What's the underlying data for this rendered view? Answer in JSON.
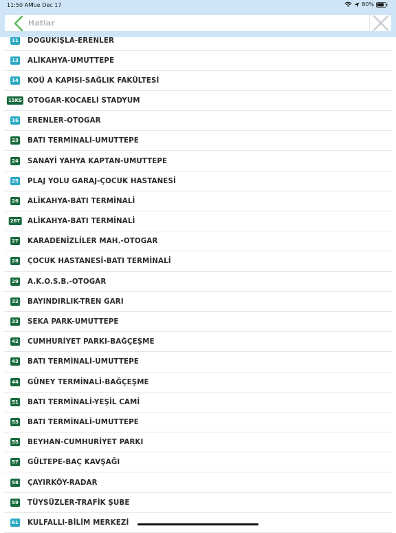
{
  "status": {
    "time": "11:50 AM",
    "date": "Tue Dec 17",
    "battery": "80%"
  },
  "search": {
    "placeholder": "Hatlar"
  },
  "colors": {
    "header_bg": "#cfe5f7",
    "badge_teal": "#2aa8c3",
    "badge_green": "#176a3c",
    "back_arrow": "#5cb85c"
  },
  "routes": [
    {
      "code": "11",
      "name": "DOĞUKIŞLA-ERENLER",
      "color": "teal"
    },
    {
      "code": "13",
      "name": "ALİKAHYA-UMUTTEPE",
      "color": "teal"
    },
    {
      "code": "14",
      "name": "KOÜ A KAPISI-SAĞLIK FAKÜLTESİ",
      "color": "teal"
    },
    {
      "code": "15KS",
      "name": "OTOGAR-KOCAELİ STADYUM",
      "color": "green"
    },
    {
      "code": "16",
      "name": "ERENLER-OTOGAR",
      "color": "teal"
    },
    {
      "code": "23",
      "name": "BATI TERMİNALİ-UMUTTEPE",
      "color": "green"
    },
    {
      "code": "24",
      "name": "SANAYİ YAHYA KAPTAN-UMUTTEPE",
      "color": "green"
    },
    {
      "code": "25",
      "name": "PLAJ YOLU GARAJ-ÇOCUK HASTANESİ",
      "color": "teal"
    },
    {
      "code": "26",
      "name": "ALİKAHYA-BATI TERMİNALİ",
      "color": "green"
    },
    {
      "code": "26T",
      "name": "ALİKAHYA-BATI TERMİNALİ",
      "color": "green"
    },
    {
      "code": "27",
      "name": "KARADENİZLİLER MAH.-OTOGAR",
      "color": "green"
    },
    {
      "code": "28",
      "name": "ÇOCUK HASTANESİ-BATI TERMİNALİ",
      "color": "green"
    },
    {
      "code": "29",
      "name": "A.K.O.S.B.-OTOGAR",
      "color": "green"
    },
    {
      "code": "32",
      "name": "BAYINDIRLIK-TREN GARI",
      "color": "green"
    },
    {
      "code": "33",
      "name": "SEKA PARK-UMUTTEPE",
      "color": "green"
    },
    {
      "code": "42",
      "name": "CUMHURİYET PARKI-BAĞÇEŞME",
      "color": "green"
    },
    {
      "code": "43",
      "name": "BATI TERMİNALİ-UMUTTEPE",
      "color": "green"
    },
    {
      "code": "44",
      "name": "GÜNEY TERMİNALİ-BAĞÇEŞME",
      "color": "green"
    },
    {
      "code": "51",
      "name": "BATI TERMİNALİ-YEŞİL CAMİ",
      "color": "green"
    },
    {
      "code": "53",
      "name": "BATI TERMİNALİ-UMUTTEPE",
      "color": "green"
    },
    {
      "code": "55",
      "name": "BEYHAN-CUMHURİYET PARKI",
      "color": "green"
    },
    {
      "code": "57",
      "name": "GÜLTEPE-BAÇ KAVŞAĞI",
      "color": "green"
    },
    {
      "code": "58",
      "name": "ÇAYIRKÖY-RADAR",
      "color": "green"
    },
    {
      "code": "59",
      "name": "TÜYSÜZLER-TRAFİK ŞUBE",
      "color": "green"
    },
    {
      "code": "61",
      "name": "KULFALLI-BİLİM MERKEZİ",
      "color": "teal"
    }
  ]
}
